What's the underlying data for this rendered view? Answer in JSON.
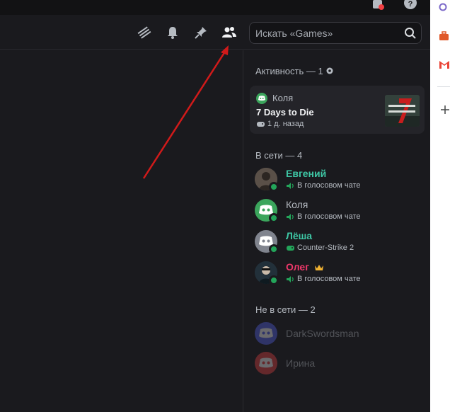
{
  "header": {
    "search_placeholder": "Искать «Games»",
    "icons": [
      "threads-icon",
      "bell-icon",
      "pin-icon",
      "members-icon",
      "search-icon"
    ]
  },
  "members": {
    "activity_title": "Активность — 1",
    "activity": {
      "user": "Коля",
      "game": "7 Days to Die",
      "time": "1 д. назад"
    },
    "online_title": "В сети — 4",
    "online": [
      {
        "name": "Евгений",
        "sub": "В голосовом чате",
        "color": "#3ec7a5"
      },
      {
        "name": "Коля",
        "sub": "В голосовом чате",
        "color": "#b5bac1"
      },
      {
        "name": "Лёша",
        "sub": "Counter-Strike 2",
        "color": "#3ec7a5"
      },
      {
        "name": "Олег",
        "sub": "В голосовом чате",
        "color": "#f0386b"
      }
    ],
    "offline_title": "Не в сети — 2",
    "offline": [
      {
        "name": "DarkSwordsman"
      },
      {
        "name": "Ирина"
      }
    ]
  },
  "colors": {
    "accent_green": "#23a55a",
    "arrow_red": "#d11a1a"
  }
}
